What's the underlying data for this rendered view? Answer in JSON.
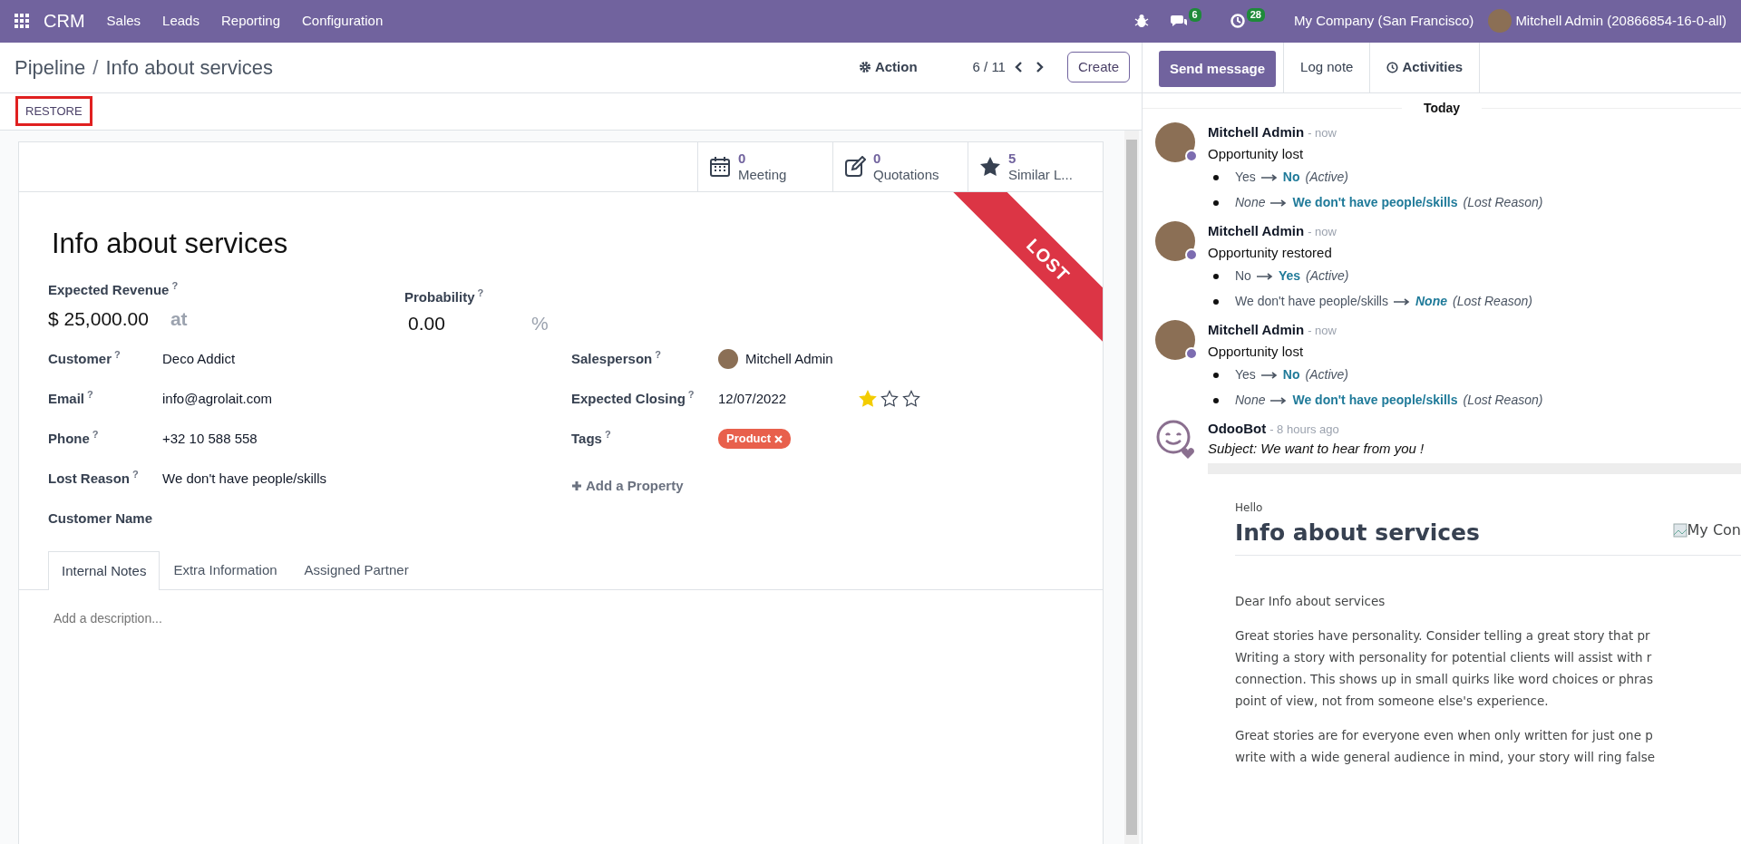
{
  "navbar": {
    "app": "CRM",
    "menus": [
      "Sales",
      "Leads",
      "Reporting",
      "Configuration"
    ],
    "chat_count": "6",
    "activity_count": "28",
    "company": "My Company (San Francisco)",
    "user": "Mitchell Admin (20866854-16-0-all)"
  },
  "control_panel": {
    "breadcrumbs": [
      "Pipeline",
      "Info about services"
    ],
    "separator": "/",
    "action": "Action",
    "pager": "6 / 11",
    "create": "Create"
  },
  "status_bar": {
    "button": "RESTORE",
    "highlighted": true
  },
  "smart_buttons": [
    {
      "kind": "calendar",
      "count": "0",
      "label": "Meeting"
    },
    {
      "kind": "edit",
      "count": "0",
      "label": "Quotations"
    },
    {
      "kind": "star",
      "count": "5",
      "label": "Similar L..."
    }
  ],
  "ribbon": "LOST",
  "title": "Info about services",
  "revenue": {
    "label": "Expected Revenue",
    "hint": "?",
    "value": "$ 25,000.00",
    "at": "at"
  },
  "probability": {
    "label": "Probability",
    "hint": "?",
    "value": "0.00",
    "unit": "%"
  },
  "left_fields": [
    {
      "label": "Customer",
      "hint": "?",
      "value": "Deco Addict"
    },
    {
      "label": "Email",
      "hint": "?",
      "value": "info@agrolait.com"
    },
    {
      "label": "Phone",
      "hint": "?",
      "value": "+32 10 588 558"
    },
    {
      "label": "Lost Reason",
      "hint": "?",
      "value": "We don't have people/skills"
    },
    {
      "label": "Customer Name"
    }
  ],
  "right_fields": [
    {
      "kind": "user",
      "label": "Salesperson",
      "hint": "?",
      "value": "Mitchell Admin"
    },
    {
      "kind": "date",
      "label": "Expected Closing",
      "hint": "?",
      "value": "12/07/2022",
      "stars": 1
    },
    {
      "kind": "tags",
      "label": "Tags",
      "hint": "?",
      "tags": [
        "Product"
      ]
    }
  ],
  "add_property": "Add a Property",
  "tabs": [
    {
      "label": "Internal Notes",
      "selected": true
    },
    {
      "label": "Extra Information",
      "selected": false
    },
    {
      "label": "Assigned Partner",
      "selected": false
    }
  ],
  "description": {
    "placeholder": "Add a description..."
  },
  "chatter": {
    "send_message": "Send message",
    "log_note": "Log note",
    "activities": "Activities",
    "date_separator": "Today",
    "messages": [
      {
        "kind": "tracking",
        "author": "Mitchell Admin",
        "time": "- now",
        "body": "Opportunity lost",
        "changes": [
          {
            "old": "Yes",
            "old_italic": false,
            "new": "No",
            "new_italic": false,
            "field": "(Active)"
          },
          {
            "old": "None",
            "old_italic": true,
            "new": "We don't have people/skills",
            "new_italic": false,
            "field": "(Lost Reason)"
          }
        ]
      },
      {
        "kind": "tracking",
        "author": "Mitchell Admin",
        "time": "- now",
        "body": "Opportunity restored",
        "changes": [
          {
            "old": "No",
            "old_italic": false,
            "new": "Yes",
            "new_italic": false,
            "field": "(Active)"
          },
          {
            "old": "We don't have people/skills",
            "old_italic": false,
            "new": "None",
            "new_italic": true,
            "field": "(Lost Reason)"
          }
        ]
      },
      {
        "kind": "tracking",
        "author": "Mitchell Admin",
        "time": "- now",
        "body": "Opportunity lost",
        "changes": [
          {
            "old": "Yes",
            "old_italic": false,
            "new": "No",
            "new_italic": false,
            "field": "(Active)"
          },
          {
            "old": "None",
            "old_italic": true,
            "new": "We don't have people/skills",
            "new_italic": false,
            "field": "(Lost Reason)"
          }
        ]
      },
      {
        "kind": "email",
        "author": "OdooBot",
        "time": "- 8 hours ago",
        "subject": "Subject: We want to hear from you !",
        "email": {
          "greeting": "Hello",
          "heading": "Info about services",
          "logo_alt": "My Con",
          "paragraphs": [
            [
              "Dear Info about services"
            ],
            [
              "Great stories have personality. Consider telling a great story that pr",
              "Writing a story with personality for potential clients will assist with r",
              "connection. This shows up in small quirks like word choices or phras",
              "point of view, not from someone else's experience."
            ],
            [
              "Great stories are for everyone even when only written for just one p",
              "write with a wide general audience in mind, your story will ring false"
            ]
          ]
        }
      }
    ]
  }
}
